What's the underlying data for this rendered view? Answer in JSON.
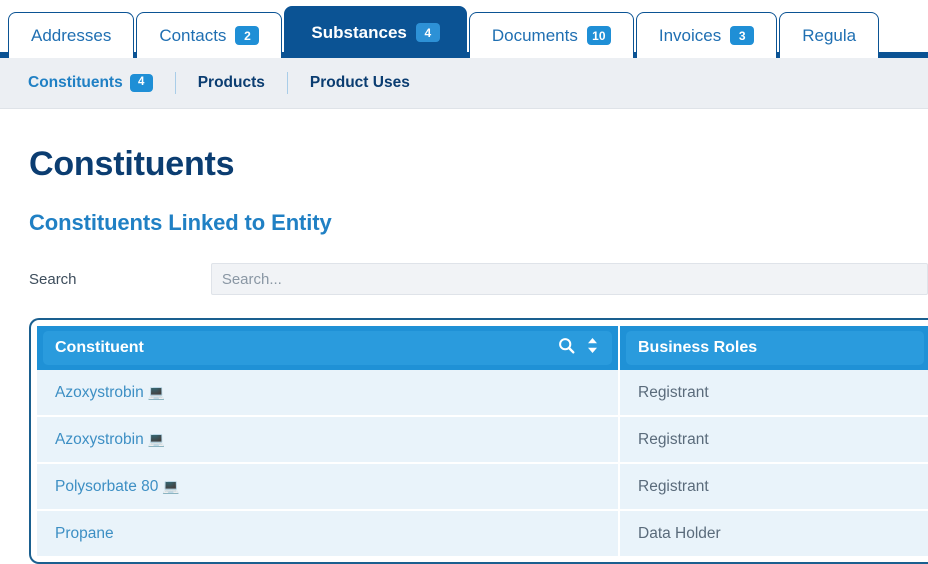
{
  "tabs": [
    {
      "label": "Addresses",
      "badge": null,
      "active": false
    },
    {
      "label": "Contacts",
      "badge": "2",
      "active": false
    },
    {
      "label": "Substances",
      "badge": "4",
      "active": true
    },
    {
      "label": "Documents",
      "badge": "10",
      "active": false
    },
    {
      "label": "Invoices",
      "badge": "3",
      "active": false
    },
    {
      "label": "Regula",
      "badge": null,
      "active": false
    }
  ],
  "subnav": [
    {
      "label": "Constituents",
      "badge": "4",
      "active": true
    },
    {
      "label": "Products",
      "badge": null,
      "active": false
    },
    {
      "label": "Product Uses",
      "badge": null,
      "active": false
    }
  ],
  "page": {
    "title": "Constituents",
    "section_title": "Constituents Linked to Entity"
  },
  "search": {
    "label": "Search",
    "placeholder": "Search...",
    "value": ""
  },
  "table": {
    "columns": [
      {
        "label": "Constituent",
        "sortable": true,
        "searchable": true
      },
      {
        "label": "Business Roles",
        "sortable": false,
        "searchable": false
      }
    ],
    "rows": [
      {
        "constituent": "Azoxystrobin",
        "icon": "laptop-icon",
        "business_roles": "Registrant"
      },
      {
        "constituent": "Azoxystrobin",
        "icon": "laptop-icon",
        "business_roles": "Registrant"
      },
      {
        "constituent": "Polysorbate 80",
        "icon": "laptop-icon",
        "business_roles": "Registrant"
      },
      {
        "constituent": "Propane",
        "icon": null,
        "business_roles": "Data Holder"
      }
    ]
  },
  "icons": {
    "laptop": "💻"
  },
  "colors": {
    "tab_active_bg": "#0b5394",
    "tab_text": "#1f6fb2",
    "badge_bg": "#1f8fd6",
    "table_header_bg": "#1f91d6",
    "table_header_inner_bg": "#2a9bdd",
    "table_row_bg": "#e9f3fa",
    "heading_navy": "#0b3d71",
    "heading_blue": "#2080c4",
    "table_border": "#1a5f8f"
  }
}
